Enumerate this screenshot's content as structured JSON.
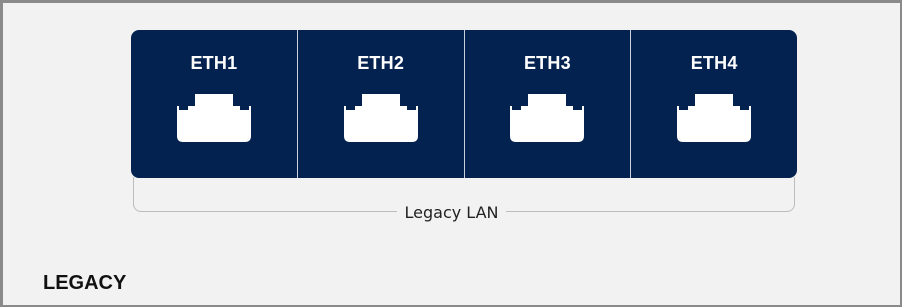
{
  "ports": [
    {
      "label": "ETH1",
      "icon": "ethernet-port-icon"
    },
    {
      "label": "ETH2",
      "icon": "ethernet-port-icon"
    },
    {
      "label": "ETH3",
      "icon": "ethernet-port-icon"
    },
    {
      "label": "ETH4",
      "icon": "ethernet-port-icon"
    }
  ],
  "group": {
    "label": "Legacy LAN"
  },
  "section": {
    "title": "LEGACY"
  },
  "colors": {
    "port_background": "#04224f",
    "port_text": "#ffffff",
    "panel_background": "#f2f2f2"
  }
}
